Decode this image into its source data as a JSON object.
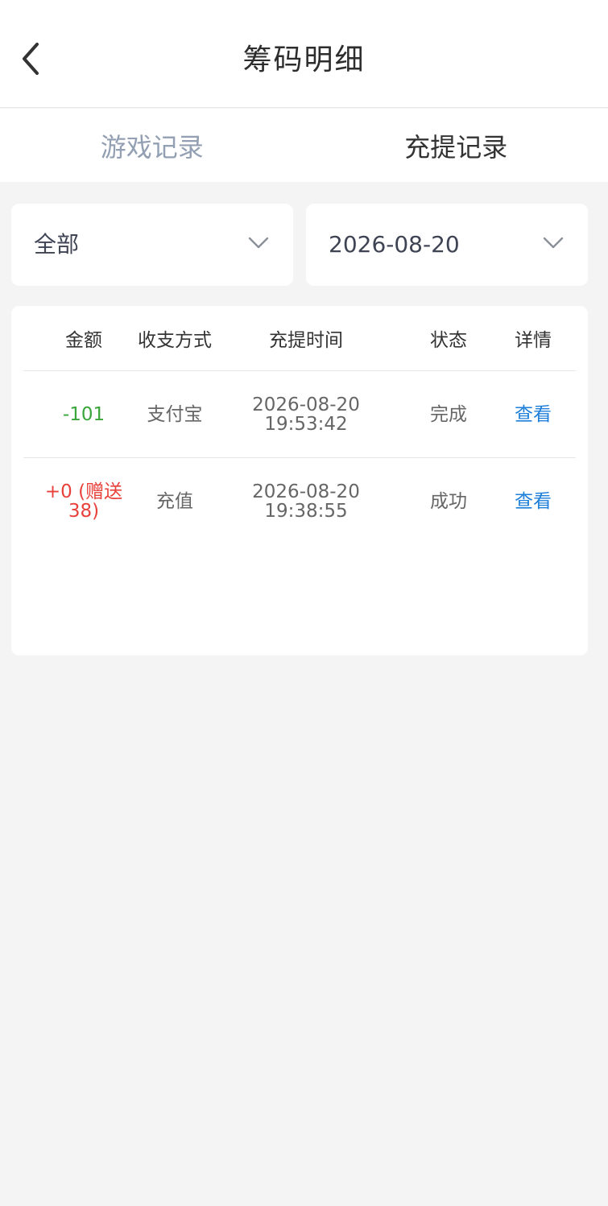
{
  "header": {
    "title": "筹码明细"
  },
  "tabs": [
    {
      "label": "游戏记录",
      "active": false
    },
    {
      "label": "充提记录",
      "active": true
    }
  ],
  "filters": {
    "type_selected": "全部",
    "date_selected": "2026-08-20"
  },
  "table": {
    "columns": [
      "金额",
      "收支方式",
      "充提时间",
      "状态",
      "详情"
    ],
    "rows": [
      {
        "amount": "-101",
        "method": "支付宝",
        "date": "2026-08-20",
        "time": "19:53:42",
        "status": "完成",
        "detail": "查看"
      },
      {
        "amount_line1": "+0 (赠送",
        "amount_line2": "38)",
        "method": "充值",
        "date": "2026-08-20",
        "time": "19:38:55",
        "status": "成功",
        "detail": "查看"
      }
    ]
  },
  "colors": {
    "positive_amount": "#e8413b",
    "negative_amount": "#3aa53a",
    "link": "#1d7fd9",
    "inactive_tab": "#93a0b3"
  },
  "icons": {
    "back": "chevron-left-icon",
    "dropdown": "chevron-down-icon"
  }
}
